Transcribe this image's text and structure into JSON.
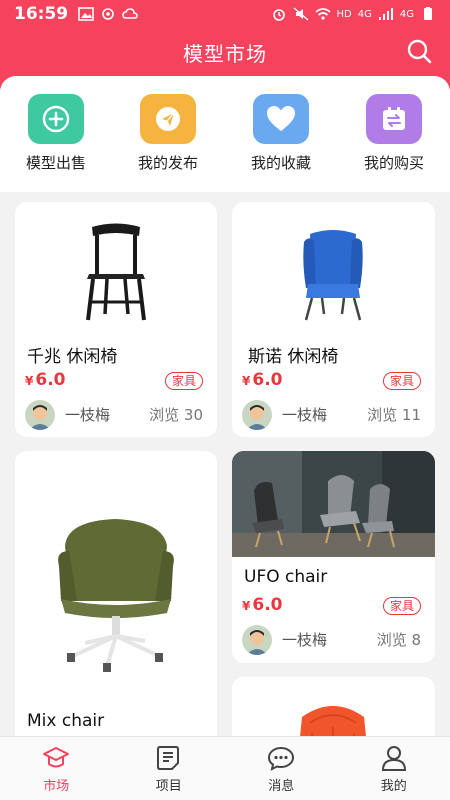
{
  "status_bar": {
    "time": "16:59",
    "indicators": [
      "4G",
      "4G",
      "HD"
    ]
  },
  "header": {
    "title": "模型市场",
    "search_icon": "search-icon"
  },
  "quick_actions": [
    {
      "label": "模型出售",
      "icon": "plus-circle-icon",
      "color": "#3ec9a0"
    },
    {
      "label": "我的发布",
      "icon": "paper-plane-icon",
      "color": "#f5b340"
    },
    {
      "label": "我的收藏",
      "icon": "heart-icon",
      "color": "#6aa8f0"
    },
    {
      "label": "我的购买",
      "icon": "calendar-swap-icon",
      "color": "#b07ce8"
    }
  ],
  "products": [
    {
      "title": "千兆 休闲椅",
      "currency": "¥",
      "price": "6.0",
      "tag": "家具",
      "author": "一枝梅",
      "views": "浏览 30"
    },
    {
      "title": "斯诺 休闲椅",
      "currency": "¥",
      "price": "6.0",
      "tag": "家具",
      "author": "一枝梅",
      "views": "浏览 11"
    },
    {
      "title": "Mix chair"
    },
    {
      "title": "UFO chair",
      "currency": "¥",
      "price": "6.0",
      "tag": "家具",
      "author": "一枝梅",
      "views": "浏览 8"
    }
  ],
  "nav": [
    {
      "label": "市场",
      "icon": "graduation-cap-icon",
      "active": true
    },
    {
      "label": "项目",
      "icon": "document-list-icon"
    },
    {
      "label": "消息",
      "icon": "chat-bubble-icon"
    },
    {
      "label": "我的",
      "icon": "user-icon"
    }
  ],
  "colors": {
    "brand": "#f5425d",
    "price": "#e8383d"
  }
}
